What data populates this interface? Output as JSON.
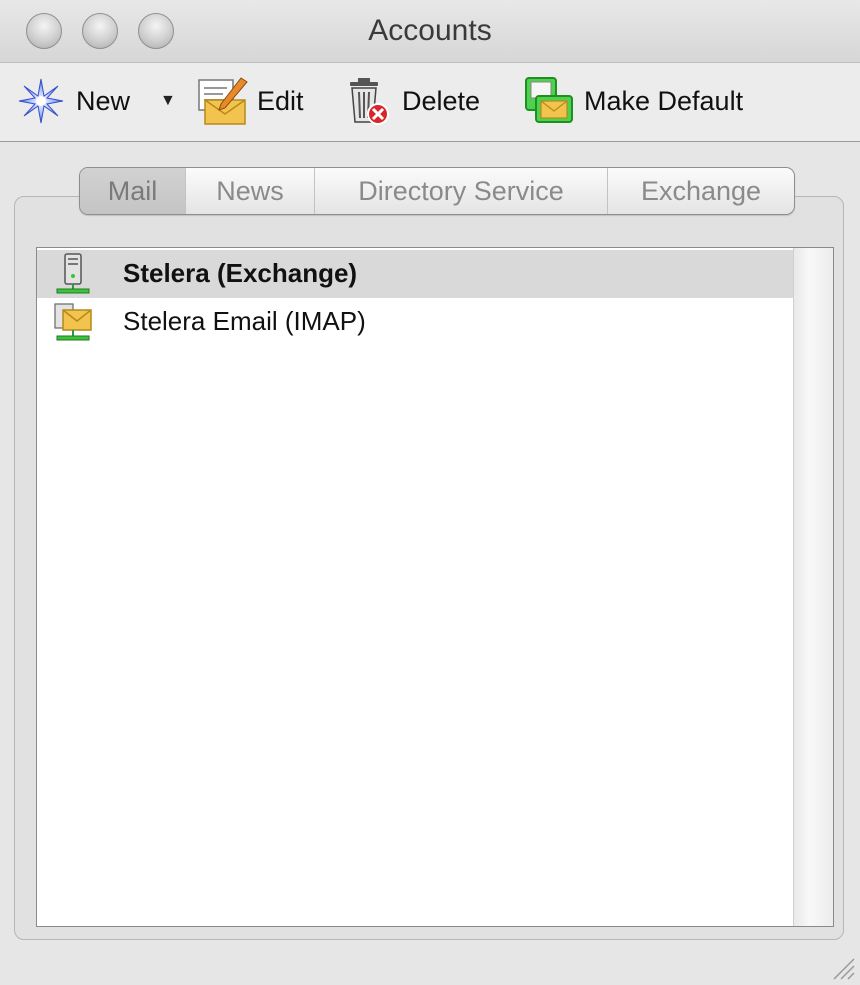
{
  "window": {
    "title": "Accounts"
  },
  "toolbar": {
    "new_label": "New",
    "new_menu_arrow": "▼",
    "edit_label": "Edit",
    "delete_label": "Delete",
    "make_default_label": "Make Default"
  },
  "tabs": [
    {
      "label": "Mail",
      "selected": true
    },
    {
      "label": "News",
      "selected": false
    },
    {
      "label": "Directory Service",
      "selected": false
    },
    {
      "label": "Exchange",
      "selected": false
    }
  ],
  "accounts": [
    {
      "name": "Stelera (Exchange)",
      "icon": "exchange-server-icon",
      "selected": true
    },
    {
      "name": "Stelera Email (IMAP)",
      "icon": "mail-server-icon",
      "selected": false
    }
  ],
  "colors": {
    "selection": "#d9d9d9",
    "default_icon_green": "#3cc23c",
    "delete_red": "#d8262a"
  }
}
